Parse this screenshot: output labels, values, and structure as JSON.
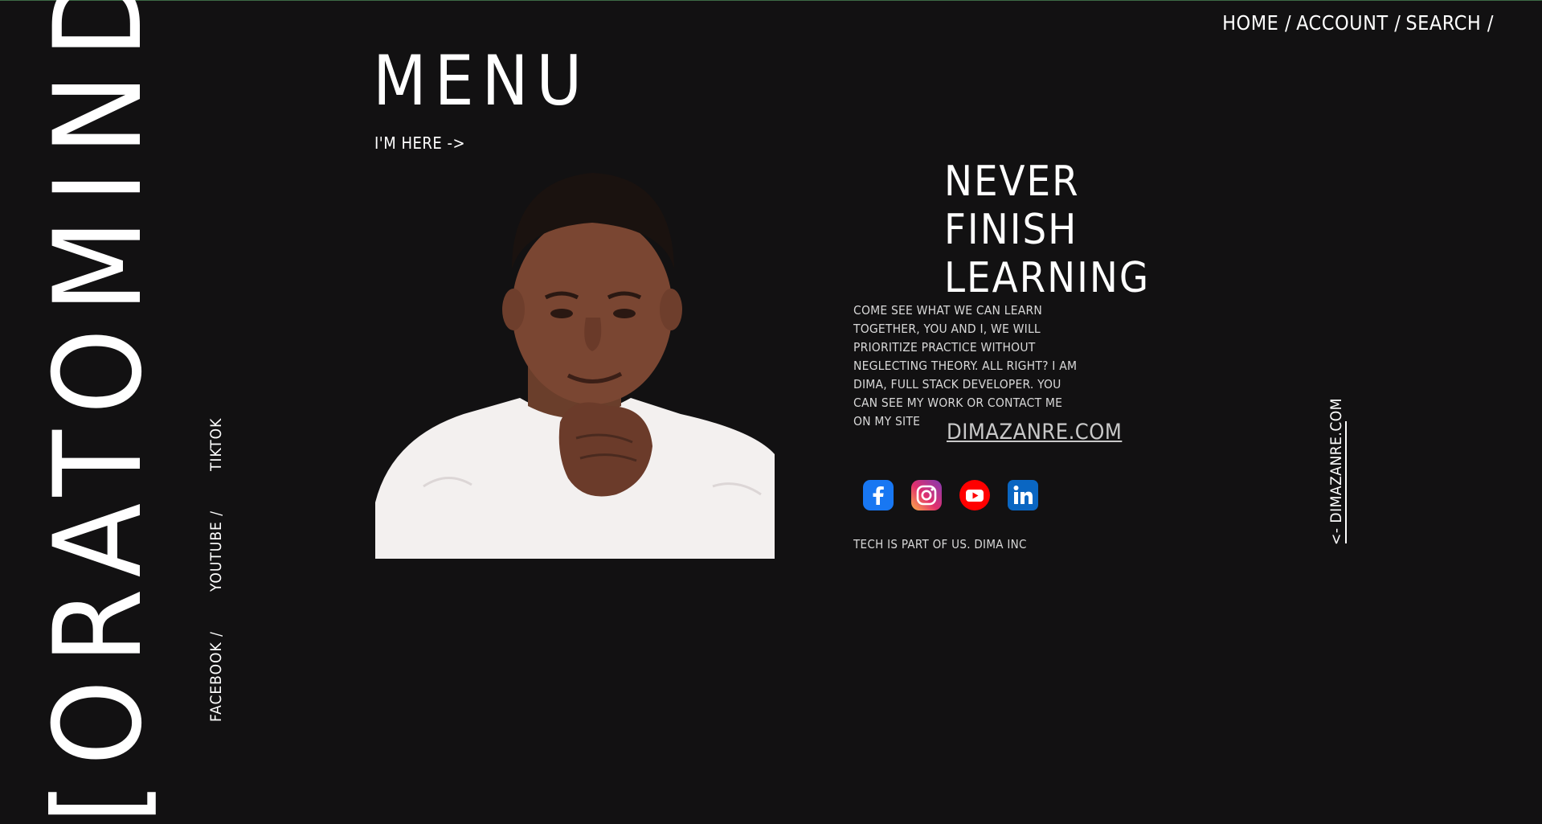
{
  "brand": {
    "name": "[ORATOMIND]"
  },
  "social_vertical": [
    {
      "label": "FACEBOOK /"
    },
    {
      "label": "YOUTUBE /"
    },
    {
      "label": "TIKTOK"
    }
  ],
  "nav": {
    "home": "HOME /",
    "account": "ACCOUNT /",
    "search": "SEARCH /"
  },
  "menu": {
    "title": "MENU",
    "cta": "I'M HERE ->"
  },
  "hero": {
    "headline": [
      "NEVER",
      "FINISH",
      "LEARNING"
    ],
    "blurb": "COME SEE WHAT WE CAN LEARN TOGETHER, YOU AND I, WE WILL PRIORITIZE PRACTICE WITHOUT NEGLECTING THEORY. ALL RIGHT? I AM DIMA, FULL STACK DEVELOPER. YOU CAN SEE MY WORK OR CONTACT ME ON MY SITE",
    "site": "DIMAZANRE.COM",
    "footer": "TECH IS PART OF US. DIMA INC"
  },
  "socials": [
    {
      "icon": "facebook-icon",
      "color": "#1877f2"
    },
    {
      "icon": "instagram-icon",
      "color": "#d6249f"
    },
    {
      "icon": "youtube-icon",
      "color": "#ff0000"
    },
    {
      "icon": "linkedin-icon",
      "color": "#0a66c2"
    }
  ],
  "side_link": {
    "label": "<- DIMAZANRE.COM"
  },
  "colors": {
    "background": "#121112",
    "text": "#ffffff",
    "muted": "#d8d8d8"
  }
}
